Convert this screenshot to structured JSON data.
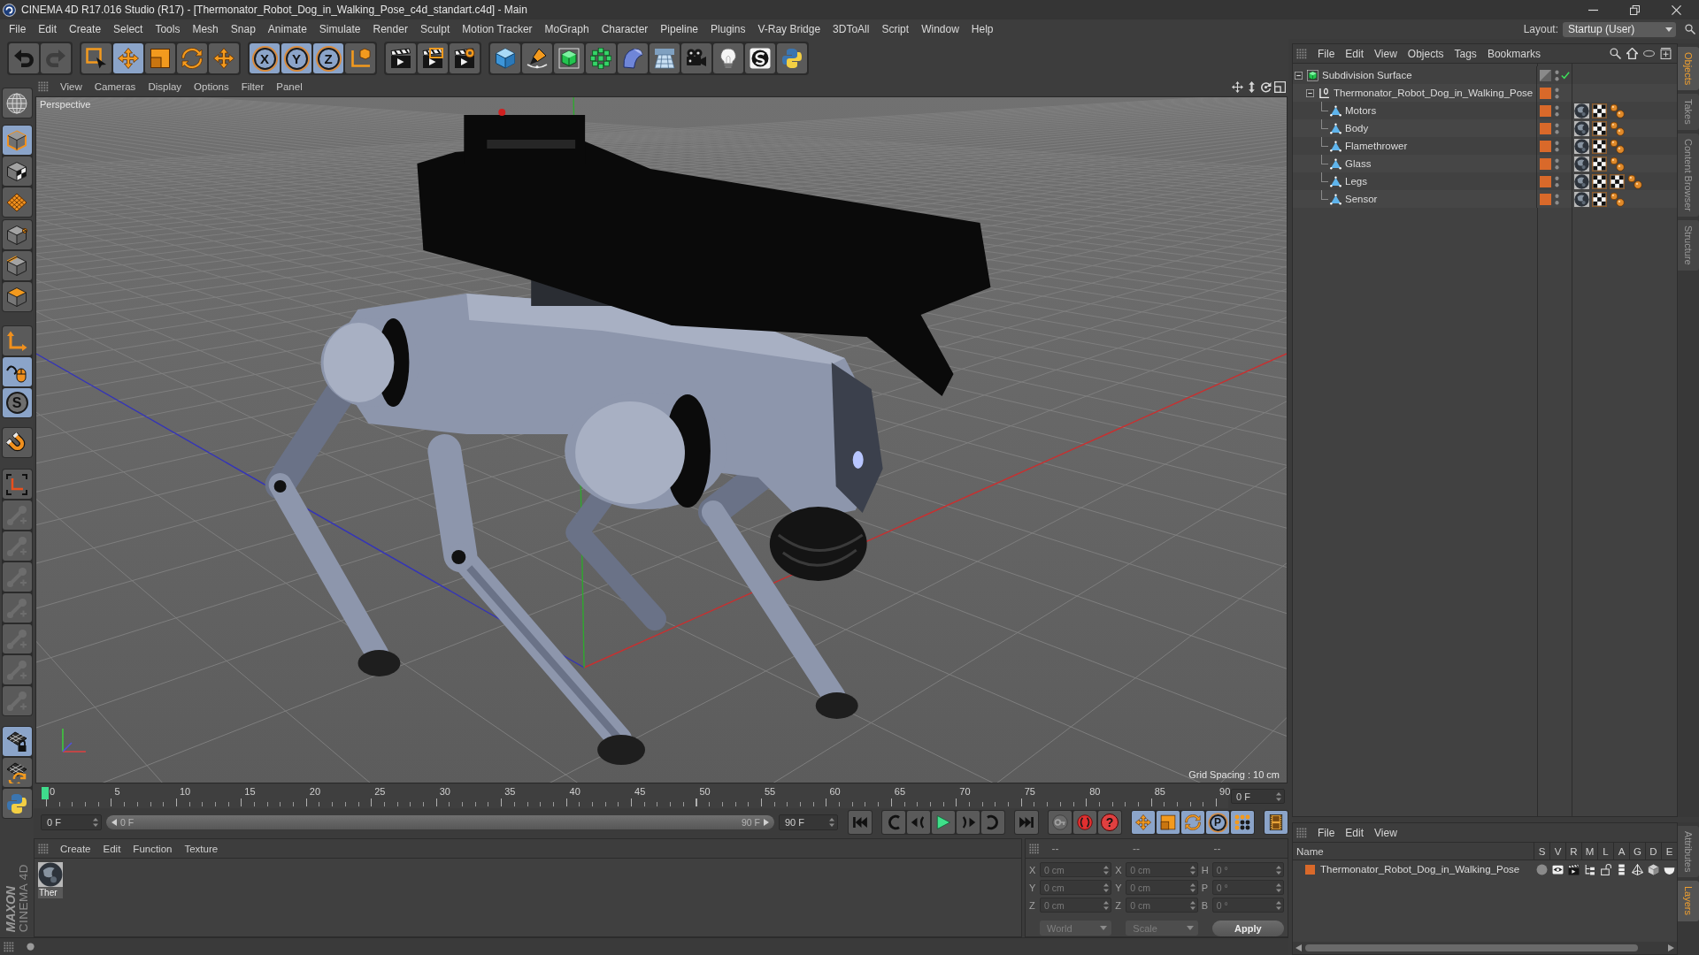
{
  "window": {
    "title": "CINEMA 4D R17.016 Studio (R17) - [Thermonator_Robot_Dog_in_Walking_Pose_c4d_standart.c4d] - Main"
  },
  "menu": [
    "File",
    "Edit",
    "Create",
    "Select",
    "Tools",
    "Mesh",
    "Snap",
    "Animate",
    "Simulate",
    "Render",
    "Sculpt",
    "Motion Tracker",
    "MoGraph",
    "Character",
    "Pipeline",
    "Plugins",
    "V-Ray Bridge",
    "3DToAll",
    "Script",
    "Window",
    "Help"
  ],
  "layout": {
    "label": "Layout:",
    "value": "Startup (User)"
  },
  "toolbar": [
    [
      {
        "kind": "undo",
        "selected": false,
        "disabled": false
      },
      {
        "kind": "redo",
        "selected": false,
        "disabled": true
      }
    ],
    [
      {
        "kind": "live-select",
        "selected": false,
        "disabled": false
      },
      {
        "kind": "move",
        "selected": true,
        "disabled": false
      },
      {
        "kind": "scale",
        "selected": false,
        "disabled": false
      },
      {
        "kind": "rotate",
        "selected": false,
        "disabled": false
      },
      {
        "kind": "recent-tool",
        "selected": false,
        "disabled": false
      }
    ],
    [
      {
        "kind": "axis-lock",
        "label": "X",
        "selected": true,
        "disabled": false
      },
      {
        "kind": "axis-lock",
        "label": "Y",
        "selected": true,
        "disabled": false
      },
      {
        "kind": "axis-lock",
        "label": "Z",
        "selected": true,
        "disabled": false
      },
      {
        "kind": "coordinates",
        "selected": false,
        "disabled": false
      }
    ],
    [
      {
        "kind": "render-view",
        "selected": false,
        "disabled": false
      },
      {
        "kind": "render-picture",
        "selected": false,
        "disabled": false
      },
      {
        "kind": "render-settings",
        "selected": false,
        "disabled": false
      }
    ],
    [
      {
        "kind": "cube",
        "selected": false,
        "disabled": false
      },
      {
        "kind": "pen",
        "selected": false,
        "disabled": false
      },
      {
        "kind": "subdivision",
        "selected": false,
        "disabled": false
      },
      {
        "kind": "cloner",
        "selected": false,
        "disabled": false
      },
      {
        "kind": "deformer",
        "selected": false,
        "disabled": false
      },
      {
        "kind": "floor",
        "selected": false,
        "disabled": false
      },
      {
        "kind": "camera",
        "selected": false,
        "disabled": false
      },
      {
        "kind": "light",
        "selected": false,
        "disabled": false
      },
      {
        "kind": "sketch",
        "selected": false,
        "disabled": false
      },
      {
        "kind": "python",
        "selected": false,
        "disabled": false
      }
    ]
  ],
  "modes": [
    [
      {
        "kind": "make-editable",
        "selected": false,
        "disabled": false
      }
    ],
    [
      {
        "kind": "model",
        "selected": true,
        "disabled": false
      },
      {
        "kind": "texture",
        "selected": false,
        "disabled": false
      },
      {
        "kind": "workplane",
        "selected": false,
        "disabled": false
      }
    ],
    [
      {
        "kind": "points",
        "selected": false,
        "disabled": false
      },
      {
        "kind": "edges",
        "selected": false,
        "disabled": false
      },
      {
        "kind": "polygons",
        "selected": false,
        "disabled": false
      }
    ],
    [
      {
        "kind": "axis-mode",
        "selected": false,
        "disabled": false
      },
      {
        "kind": "tweak",
        "selected": true,
        "disabled": false
      },
      {
        "kind": "solo",
        "label": "S",
        "selected": true,
        "disabled": false
      }
    ],
    [
      {
        "kind": "snap",
        "selected": false,
        "disabled": false
      }
    ],
    [
      {
        "kind": "axis-corners",
        "selected": false,
        "disabled": false
      },
      {
        "kind": "joint",
        "selected": false,
        "disabled": true
      },
      {
        "kind": "joint",
        "selected": false,
        "disabled": true
      },
      {
        "kind": "joint",
        "selected": false,
        "disabled": true
      },
      {
        "kind": "joint",
        "selected": false,
        "disabled": true
      },
      {
        "kind": "joint",
        "selected": false,
        "disabled": true
      },
      {
        "kind": "joint",
        "selected": false,
        "disabled": true
      },
      {
        "kind": "joint",
        "selected": false,
        "disabled": true
      }
    ],
    [
      {
        "kind": "workplane-lock",
        "selected": true,
        "disabled": false
      },
      {
        "kind": "workplane-rotate",
        "selected": false,
        "disabled": false
      },
      {
        "kind": "python",
        "selected": false,
        "disabled": false
      }
    ]
  ],
  "brand": {
    "company": "MAXON",
    "product": "CINEMA 4D"
  },
  "viewport": {
    "menu": [
      "View",
      "Cameras",
      "Display",
      "Options",
      "Filter",
      "Panel"
    ],
    "camera": "Perspective",
    "grid_spacing": "Grid Spacing : 10 cm"
  },
  "timeline": {
    "ruler": [
      "0",
      "5",
      "10",
      "15",
      "20",
      "25",
      "30",
      "35",
      "40",
      "45",
      "50",
      "55",
      "60",
      "65",
      "70",
      "75",
      "80",
      "85",
      "90"
    ],
    "playhead": {
      "level": 0
    },
    "current_frame": "0 F",
    "start_frame": "0 F",
    "range": {
      "start": "0 F",
      "end": "90 F",
      "level": 1
    },
    "end_frame": "90 F",
    "controls": [
      [
        {
          "kind": "go-start",
          "selected": false
        }
      ],
      [
        {
          "kind": "prev-key",
          "selected": false
        },
        {
          "kind": "prev-frame",
          "selected": false
        },
        {
          "kind": "play",
          "selected": false
        },
        {
          "kind": "next-frame",
          "selected": false
        },
        {
          "kind": "next-key",
          "selected": false
        }
      ],
      [
        {
          "kind": "go-end",
          "selected": false
        }
      ],
      [
        {
          "kind": "record-active",
          "selected": false
        },
        {
          "kind": "record",
          "selected": false
        },
        {
          "kind": "autokey",
          "label": "?",
          "selected": false
        }
      ],
      [
        {
          "kind": "key-move",
          "selected": true
        },
        {
          "kind": "key-scale",
          "selected": true
        },
        {
          "kind": "key-rotate",
          "selected": true
        },
        {
          "kind": "key-param",
          "label": "P",
          "selected": true
        },
        {
          "kind": "key-points",
          "selected": true
        }
      ],
      [
        {
          "kind": "film",
          "selected": true
        }
      ]
    ]
  },
  "materials": {
    "menu": [
      "Create",
      "Edit",
      "Function",
      "Texture"
    ],
    "items": [
      {
        "name": "Ther",
        "selected": false
      }
    ]
  },
  "coordinates": {
    "headers": [
      "--",
      "--",
      "--"
    ],
    "columns": [
      {
        "fields": [
          {
            "label": "X",
            "value": "0 cm",
            "disabled": true
          },
          {
            "label": "Y",
            "value": "0 cm",
            "disabled": true
          },
          {
            "label": "Z",
            "value": "0 cm",
            "disabled": true
          }
        ],
        "control": {
          "kind": "dropdown",
          "text": "World",
          "disabled": true
        }
      },
      {
        "fields": [
          {
            "label": "X",
            "value": "0 cm",
            "disabled": true
          },
          {
            "label": "Y",
            "value": "0 cm",
            "disabled": true
          },
          {
            "label": "Z",
            "value": "0 cm",
            "disabled": true
          }
        ],
        "control": {
          "kind": "dropdown",
          "text": "Scale",
          "disabled": true
        }
      },
      {
        "fields": [
          {
            "label": "H",
            "value": "0 °",
            "disabled": true
          },
          {
            "label": "P",
            "value": "0 °",
            "disabled": true
          },
          {
            "label": "B",
            "value": "0 °",
            "disabled": true
          }
        ],
        "control": {
          "kind": "button",
          "text": "Apply",
          "disabled": false
        }
      }
    ]
  },
  "objects": {
    "menu": [
      "File",
      "Edit",
      "View",
      "Objects",
      "Tags",
      "Bookmarks"
    ],
    "tree": [
      {
        "name": "Subdivision Surface",
        "kind": "subdivision",
        "expanded": true,
        "selected": false,
        "in_layer": false,
        "check": true,
        "children": [
          {
            "name": "Thermonator_Robot_Dog_in_Walking_Pose",
            "kind": "null",
            "expanded": true,
            "selected": false,
            "in_layer": true,
            "check": false,
            "children": [
              {
                "name": "Motors",
                "kind": "polygon",
                "selected": false,
                "in_layer": true,
                "check": false,
                "tags": [
                  {
                    "kind": "material"
                  },
                  {
                    "kind": "uvw"
                  },
                  {
                    "kind": "phong"
                  }
                ]
              },
              {
                "name": "Body",
                "kind": "polygon",
                "selected": false,
                "in_layer": true,
                "check": false,
                "tags": [
                  {
                    "kind": "material"
                  },
                  {
                    "kind": "uvw"
                  },
                  {
                    "kind": "phong"
                  }
                ]
              },
              {
                "name": "Flamethrower",
                "kind": "polygon",
                "selected": false,
                "in_layer": true,
                "check": false,
                "tags": [
                  {
                    "kind": "material"
                  },
                  {
                    "kind": "uvw"
                  },
                  {
                    "kind": "phong"
                  }
                ]
              },
              {
                "name": "Glass",
                "kind": "polygon",
                "selected": false,
                "in_layer": true,
                "check": false,
                "tags": [
                  {
                    "kind": "material"
                  },
                  {
                    "kind": "uvw"
                  },
                  {
                    "kind": "phong"
                  }
                ]
              },
              {
                "name": "Legs",
                "kind": "polygon",
                "selected": false,
                "in_layer": true,
                "check": false,
                "tags": [
                  {
                    "kind": "material"
                  },
                  {
                    "kind": "uvw"
                  },
                  {
                    "kind": "uvw"
                  },
                  {
                    "kind": "phong"
                  }
                ]
              },
              {
                "name": "Sensor",
                "kind": "polygon",
                "selected": false,
                "in_layer": true,
                "check": false,
                "tags": [
                  {
                    "kind": "material"
                  },
                  {
                    "kind": "uvw"
                  },
                  {
                    "kind": "phong"
                  }
                ]
              }
            ]
          }
        ]
      }
    ]
  },
  "layers": {
    "menu": [
      "File",
      "Edit",
      "View"
    ],
    "columns": [
      "Name",
      "S",
      "V",
      "R",
      "M",
      "L",
      "A",
      "G",
      "D",
      "E"
    ],
    "items": [
      {
        "name": "Thermonator_Robot_Dog_in_Walking_Pose",
        "color": "#d9692a",
        "toggles": [
          {
            "kind": "solo",
            "on": false
          },
          {
            "kind": "view",
            "on": true
          },
          {
            "kind": "render",
            "on": true
          },
          {
            "kind": "manager",
            "on": true
          },
          {
            "kind": "lock",
            "on": false
          },
          {
            "kind": "animation",
            "on": true
          },
          {
            "kind": "generators",
            "on": true
          },
          {
            "kind": "deformers",
            "on": true
          },
          {
            "kind": "expressions",
            "on": true
          }
        ]
      }
    ]
  },
  "side_tabs": {
    "top": [
      {
        "label": "Objects",
        "selected": true
      },
      {
        "label": "Takes",
        "selected": false
      },
      {
        "label": "Content Browser",
        "selected": false
      },
      {
        "label": "Structure",
        "selected": false
      }
    ],
    "bottom": [
      {
        "label": "Attributes",
        "selected": false
      },
      {
        "label": "Layers",
        "selected": true
      }
    ]
  }
}
